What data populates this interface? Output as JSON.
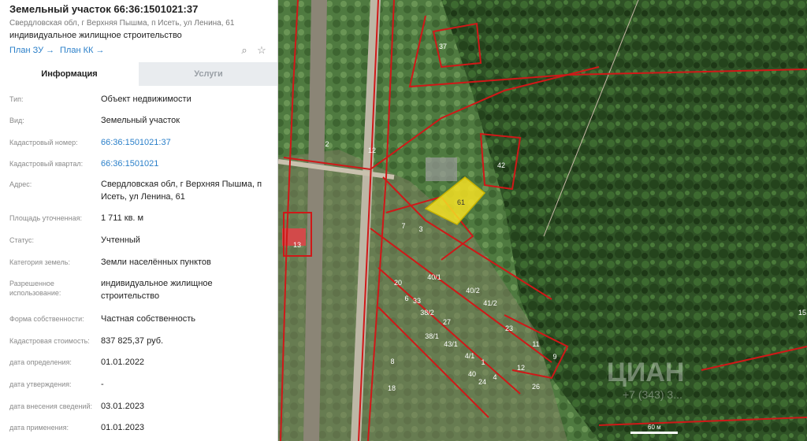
{
  "header": {
    "title": "Земельный участок 66:36:1501021:37",
    "address": "Свердловская обл, г Верхняя Пышма, п Исеть, ул Ленина, 61",
    "usage": "индивидуальное жилищное строительство",
    "plan_zu": "План ЗУ →",
    "plan_kk": "План КК →"
  },
  "tabs": {
    "info": "Информация",
    "services": "Услуги"
  },
  "rows": [
    {
      "label": "Тип:",
      "value": "Объект недвижимости"
    },
    {
      "label": "Вид:",
      "value": "Земельный участок"
    },
    {
      "label": "Кадастровый номер:",
      "value": "66:36:1501021:37"
    },
    {
      "label": "Кадастровый квартал:",
      "value": "66:36:1501021"
    },
    {
      "label": "Адрес:",
      "value": "Свердловская обл, г Верхняя Пышма, п Исеть, ул Ленина, 61"
    },
    {
      "label": "Площадь уточненная:",
      "value": "1 711 кв. м"
    },
    {
      "label": "Статус:",
      "value": "Учтенный"
    },
    {
      "label": "Категория земель:",
      "value": "Земли населённых пунктов"
    },
    {
      "label": "Разрешенное использование:",
      "value": "индивидуальное жилищное строительство"
    },
    {
      "label": "Форма собственности:",
      "value": "Частная собственность"
    },
    {
      "label": "Кадастровая стоимость:",
      "value": "837 825,37 руб."
    },
    {
      "label": "дата определения:",
      "value": "01.01.2022"
    },
    {
      "label": "дата утверждения:",
      "value": "-"
    },
    {
      "label": "дата внесения сведений:",
      "value": "03.01.2023"
    },
    {
      "label": "дата применения:",
      "value": "01.01.2023"
    }
  ],
  "map": {
    "parcel_labels": [
      "37",
      "42",
      "2",
      "12",
      "61",
      "13",
      "7",
      "3",
      "20",
      "40/1",
      "40/2",
      "41/2",
      "6",
      "33",
      "38/2",
      "27",
      "38/1",
      "43/1",
      "4/1",
      "1",
      "40",
      "24",
      "4",
      "12",
      "23",
      "11",
      "9",
      "26",
      "18",
      "15",
      "8"
    ],
    "watermark": "ЦИАН",
    "watermark_phone": "+7 (343) 3...",
    "scale": "60 м",
    "colors": {
      "highlight": "#f5e025",
      "boundary": "#d01818",
      "forest": "#27481f"
    }
  }
}
